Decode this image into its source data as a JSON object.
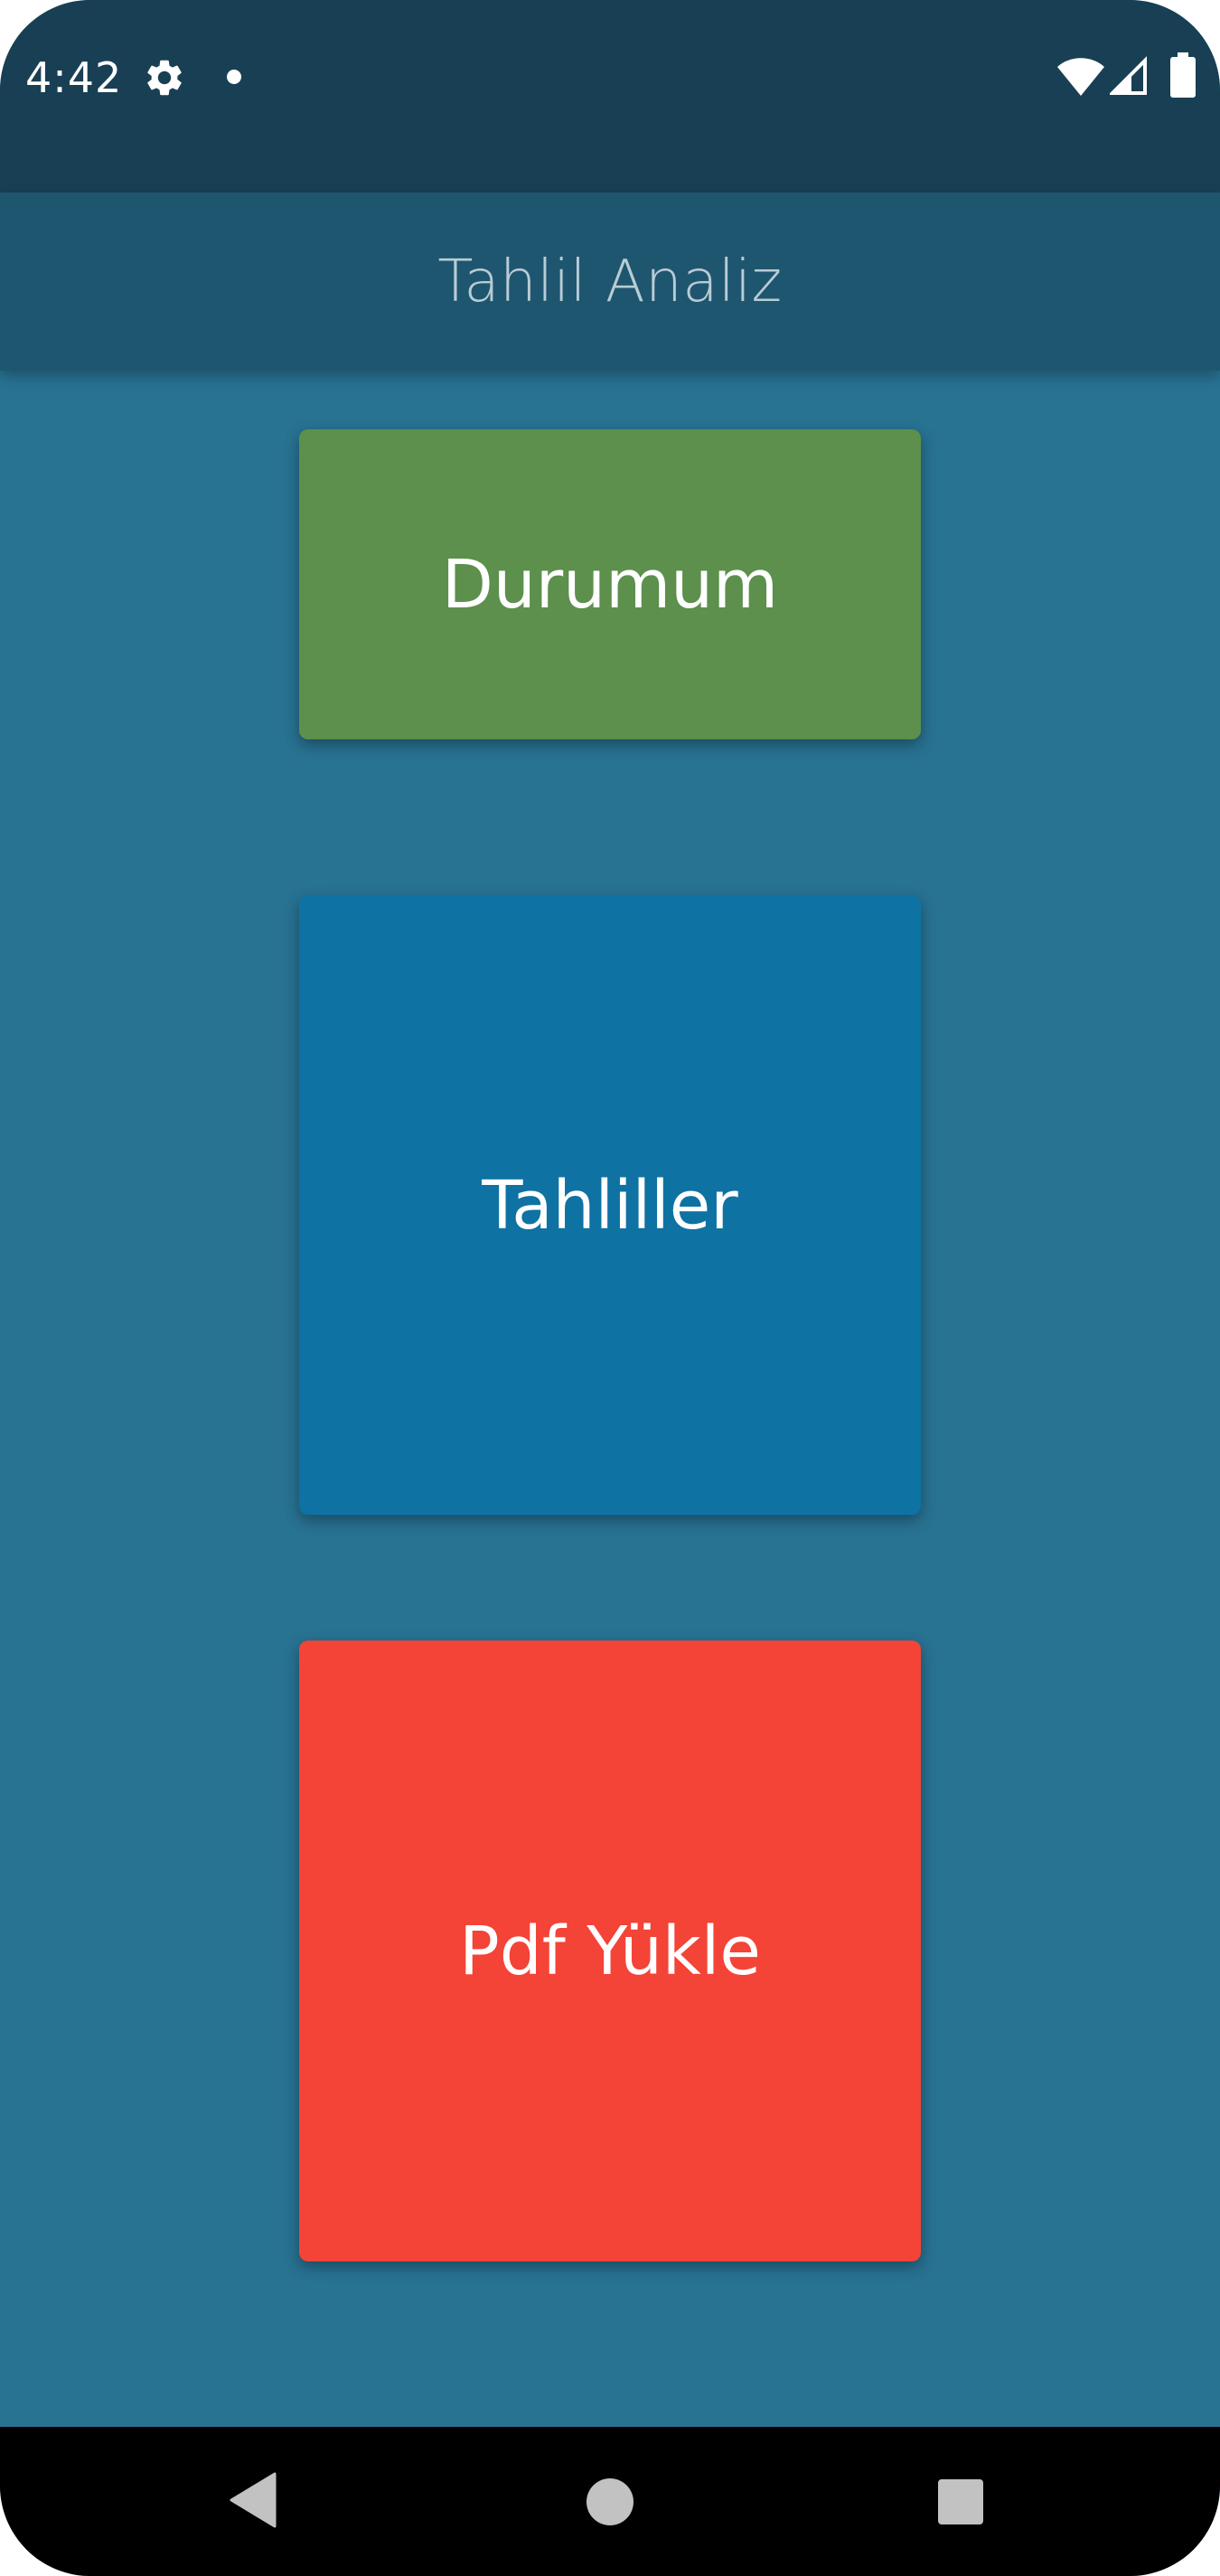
{
  "status_bar": {
    "time": "4:42",
    "icons": [
      "gear-icon",
      "notification-dot-icon",
      "wifi-icon",
      "signal-icon",
      "battery-icon"
    ]
  },
  "app_bar": {
    "title": "Tahlil Analiz"
  },
  "tiles": [
    {
      "label": "Durumum",
      "color": "#5c904c"
    },
    {
      "label": "Tahliller",
      "color": "#0e72a3"
    },
    {
      "label": "Pdf Yükle",
      "color": "#f44337"
    }
  ],
  "nav_bar": {
    "icons": [
      "back-icon",
      "home-icon",
      "recents-icon"
    ]
  },
  "colors": {
    "background": "#287292",
    "status_bar": "#193f54",
    "app_bar": "#1f566f"
  }
}
